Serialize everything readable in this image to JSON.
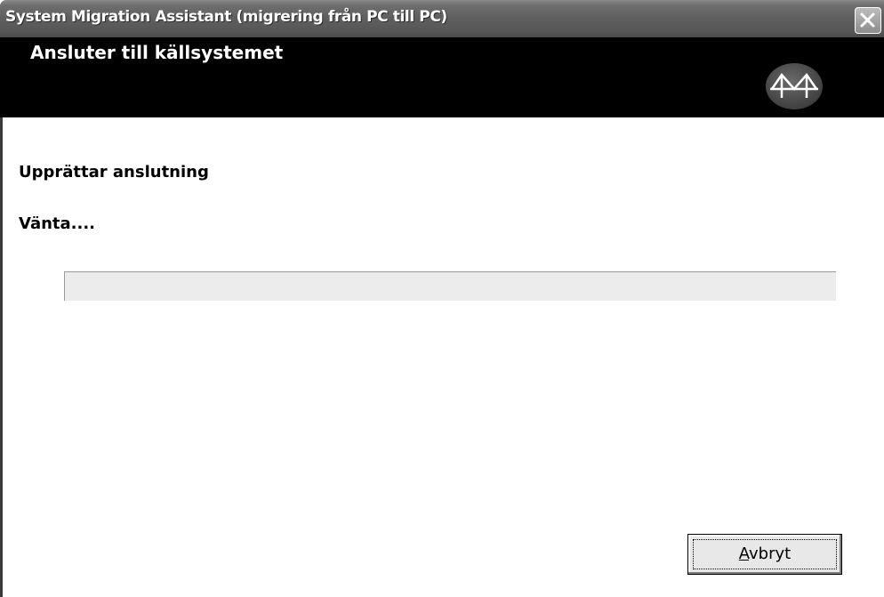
{
  "window": {
    "title": "System Migration Assistant (migrering från PC till PC)"
  },
  "header": {
    "title": "Ansluter till källsystemet",
    "logo_icon": "bridge-logo-icon"
  },
  "main": {
    "status_title": "Upprättar anslutning",
    "status_message": "Vänta....",
    "progress": {
      "fraction": 0.0
    }
  },
  "footer": {
    "cancel_button": {
      "mnemonic": "A",
      "rest": "vbryt"
    }
  },
  "icons": {
    "close": "close-icon"
  }
}
